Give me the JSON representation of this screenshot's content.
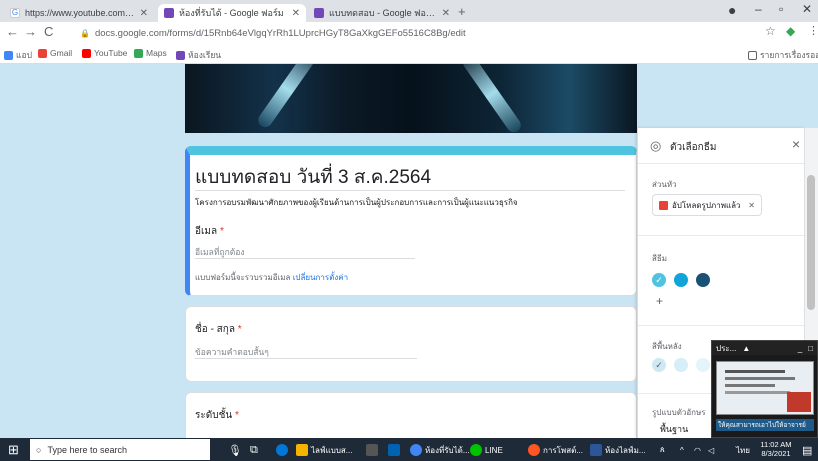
{
  "browser": {
    "tabs": [
      {
        "label": "https://www.youtube.com/watch",
        "icon": "google-icon",
        "active": false
      },
      {
        "label": "ห้องที่รับได้ - Google ฟอร์ม",
        "icon": "forms-icon",
        "active": true
      },
      {
        "label": "แบบทดสอบ - Google ฟอร์ม",
        "icon": "forms-icon",
        "active": false
      }
    ],
    "new_tab": "+",
    "address": "docs.google.com/forms/d/15Rnb64eVlgqYrRh1LUprcHGyT8GaXkgGEFo5516C8Bg/edit",
    "bookmarks": [
      {
        "label": "แอป",
        "icon": "apps-icon",
        "color": "#4285f4"
      },
      {
        "label": "Gmail",
        "icon": "gmail-icon",
        "color": "#ea4335"
      },
      {
        "label": "YouTube",
        "icon": "youtube-icon",
        "color": "#ff0000"
      },
      {
        "label": "Maps",
        "icon": "maps-icon",
        "color": "#34a853"
      },
      {
        "label": "ห้องเรียน",
        "icon": "forms-icon",
        "color": "#7248b9"
      }
    ],
    "reading_list": "รายการเรื่องรออ่าน"
  },
  "form": {
    "title": "แบบทดสอบ วันที่ 3 ส.ค.2564",
    "description": "โครงการอบรมพัฒนาศักยภาพของผู้เรียนด้านการเป็นผู้ประกอบการและการเป็นผู้แนะแนวธุรกิจ",
    "email": {
      "label": "อีเมล",
      "required": "*",
      "placeholder": "อีเมลที่ถูกต้อง",
      "note": "แบบฟอร์มนี้จะรวบรวมอีเมล",
      "change_link": "เปลี่ยนการตั้งค่า"
    },
    "name_question": {
      "label": "ชื่อ - สกุล",
      "required": "*",
      "placeholder": "ข้อความคำตอบสั้นๆ"
    },
    "level_question": {
      "label": "ระดับชั้น",
      "required": "*"
    }
  },
  "panel": {
    "title": "ตัวเลือกธีม",
    "close": "×",
    "header_section": "ส่วนหัว",
    "upload_button": "อัปโหลดรูปภาพแล้ว",
    "color_section": "สีธีม",
    "theme_colors": [
      "#4fc3e0",
      "#12a4d9",
      "#1a5276"
    ],
    "add_color": "+",
    "bg_section": "สีพื้นหลัง",
    "bg_colors": [
      "#cfe8f3",
      "#d6eef7",
      "#e3f4fa"
    ],
    "font_section": "รูปแบบตัวอักษร",
    "font_value": "พื้นฐาน"
  },
  "pip": {
    "title": "ประ...",
    "caption": "ให้คุณสามารถเอาไปให้อาจารย์"
  },
  "taskbar": {
    "search_placeholder": "Type here to search",
    "apps": [
      {
        "label": "ไลฟ์แบบส...",
        "color": "#f4b400"
      },
      {
        "label": "ห้องที่รับได้...",
        "color": "#4285f4"
      },
      {
        "label": "LINE",
        "color": "#00c300"
      },
      {
        "label": "การโพสต์...",
        "color": "#ff5722"
      },
      {
        "label": "ห้องไลฟ์ม...",
        "color": "#2b579a"
      }
    ],
    "time": "11:02 AM",
    "date": "8/3/2021",
    "lang": "ไทย"
  }
}
